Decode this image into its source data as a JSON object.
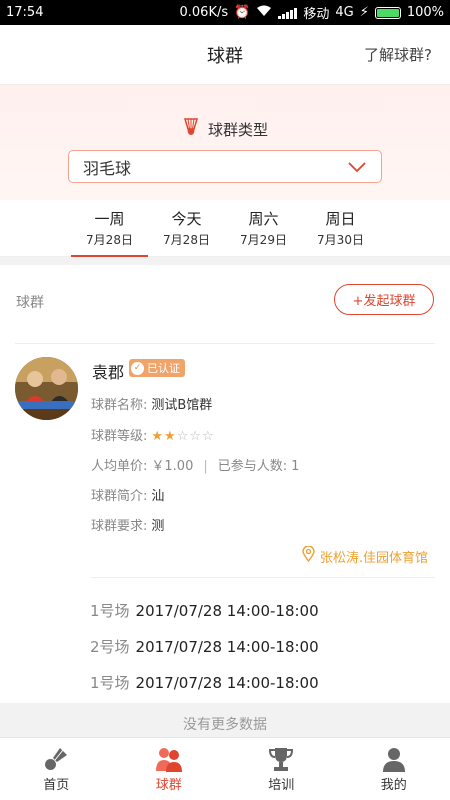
{
  "status_bar": {
    "time": "17:54",
    "speed": "0.06K/s",
    "carrier": "移动",
    "network": "4G",
    "battery": "100%"
  },
  "header": {
    "title": "球群",
    "help_link": "了解球群?"
  },
  "type_filter": {
    "label": "球群类型",
    "icon": "shuttlecock-icon",
    "selected": "羽毛球"
  },
  "day_tabs": [
    {
      "day": "一周",
      "date": "7月28日",
      "active": true
    },
    {
      "day": "今天",
      "date": "7月28日",
      "active": false
    },
    {
      "day": "周六",
      "date": "7月29日",
      "active": false
    },
    {
      "day": "周日",
      "date": "7月30日",
      "active": false
    }
  ],
  "section": {
    "label": "球群",
    "launch_button": "+发起球群"
  },
  "group": {
    "name": "袁郡",
    "badge": "已认证",
    "name_label": "球群名称:",
    "name_value": "测试B馆群",
    "level_label": "球群等级:",
    "level_rating": 2,
    "level_max": 5,
    "price_label": "人均单价:",
    "price_value": "￥1.00",
    "joined_label": "已参与人数:",
    "joined_value": "1",
    "intro_label": "球群简介:",
    "intro_value": "汕",
    "req_label": "球群要求:",
    "req_value": "测",
    "venue": "张松涛.佳园体育馆",
    "sessions": [
      {
        "court": "1号场",
        "time": "2017/07/28 14:00-18:00"
      },
      {
        "court": "2号场",
        "time": "2017/07/28 14:00-18:00"
      },
      {
        "court": "1号场",
        "time": "2017/07/28 14:00-18:00"
      }
    ]
  },
  "footer_note": "没有更多数据",
  "tab_bar": [
    {
      "label": "首页",
      "icon": "shuttlecock-icon",
      "active": false
    },
    {
      "label": "球群",
      "icon": "group-icon",
      "active": true
    },
    {
      "label": "培训",
      "icon": "trophy-icon",
      "active": false
    },
    {
      "label": "我的",
      "icon": "user-icon",
      "active": false
    }
  ],
  "colors": {
    "accent": "#e0452f",
    "star": "#f0a030",
    "badge": "#f0a46a"
  }
}
